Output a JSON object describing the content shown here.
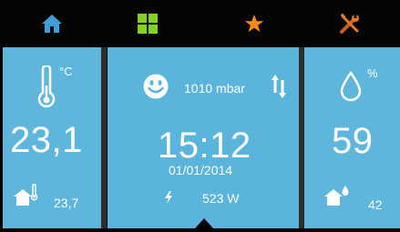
{
  "nav": {
    "home_icon": "home-icon",
    "grid_icon": "grid-icon",
    "star_icon": "star-icon",
    "tools_icon": "tools-icon"
  },
  "colors": {
    "panel": "#5fb6dd",
    "home_blue": "#3d9fd6",
    "grid_green": "#7fd321",
    "star_orange": "#f58b1f",
    "tools_orange": "#e07a22"
  },
  "left_panel": {
    "unit": "°C",
    "value": "23,1",
    "indoor_value": "23,7"
  },
  "center_panel": {
    "pressure": "1010 mbar",
    "time": "15:12",
    "date": "01/01/2014",
    "power": "523 W"
  },
  "right_panel": {
    "unit": "%",
    "value": "59",
    "indoor_value": "42"
  }
}
